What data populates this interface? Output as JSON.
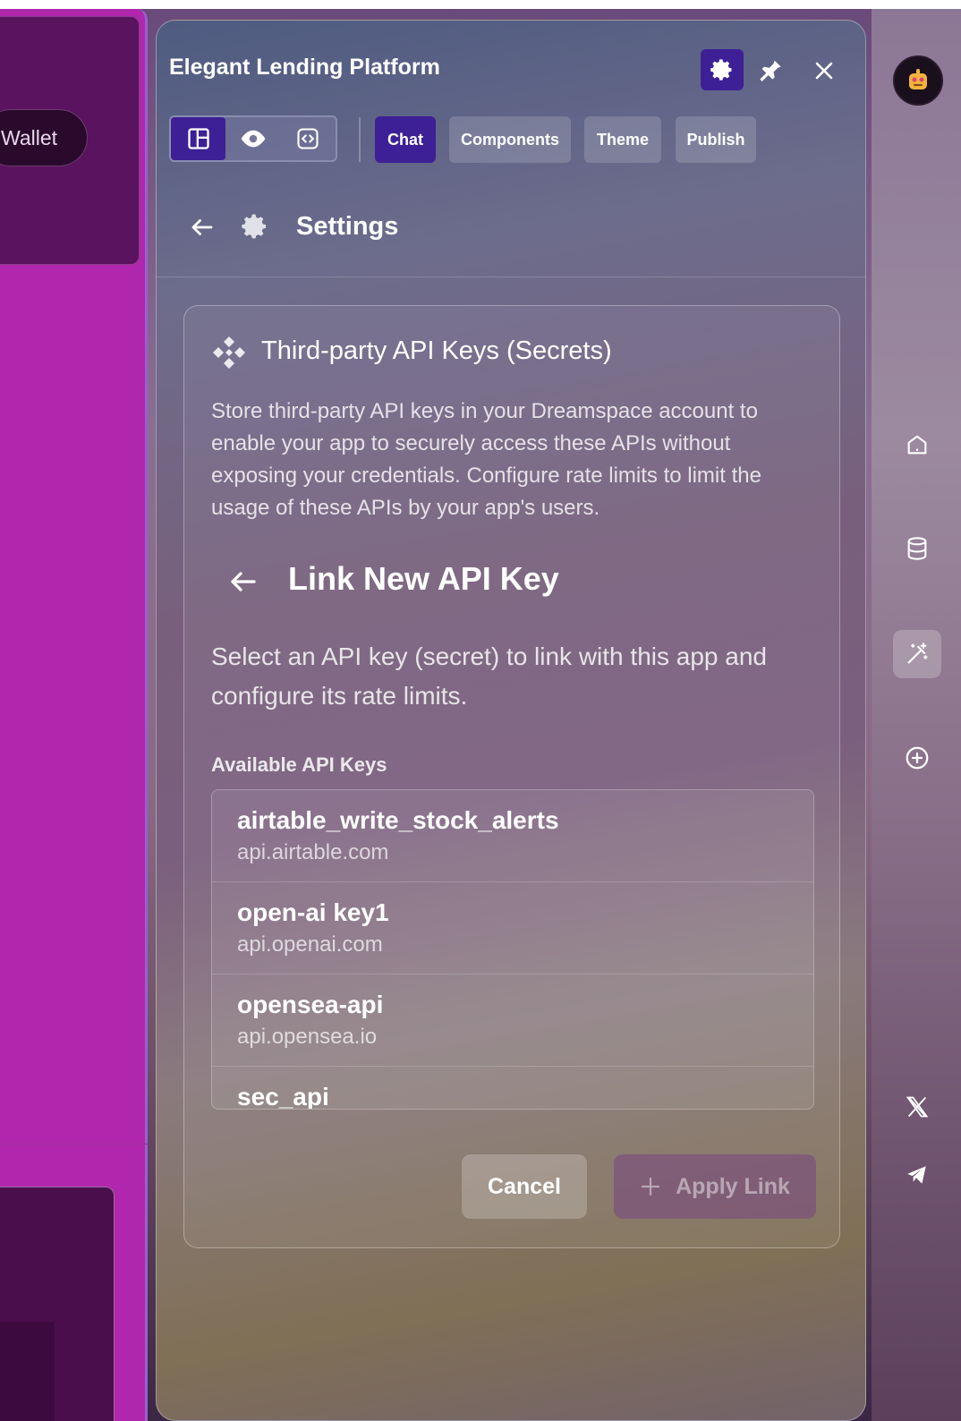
{
  "background_app": {
    "wallet_button_label": "Wallet"
  },
  "header": {
    "title": "Elegant Lending Platform"
  },
  "toolbar": {
    "tabs": [
      {
        "label": "Chat",
        "active": true
      },
      {
        "label": "Components",
        "active": false
      },
      {
        "label": "Theme",
        "active": false
      },
      {
        "label": "Publish",
        "active": false
      }
    ]
  },
  "settings": {
    "title": "Settings"
  },
  "secrets_card": {
    "title": "Third-party API Keys (Secrets)",
    "description": "Store third-party API keys in your Dreamspace account to enable your app to securely access these APIs without exposing your credentials. Configure rate limits to limit the usage of these APIs by your app's users.",
    "link_title": "Link New API Key",
    "link_description": "Select an API key (secret) to link with this app and configure its rate limits.",
    "available_label": "Available API Keys",
    "keys": [
      {
        "name": "airtable_write_stock_alerts",
        "host": "api.airtable.com"
      },
      {
        "name": "open-ai key1",
        "host": "api.openai.com"
      },
      {
        "name": "opensea-api",
        "host": "api.opensea.io"
      },
      {
        "name": "sec_api",
        "host": ""
      }
    ],
    "cancel_label": "Cancel",
    "apply_label": "Apply Link"
  },
  "colors": {
    "accent": "#3d1f96",
    "app_magenta": "#b027ad"
  },
  "icons": {
    "rail": [
      "robot-avatar-icon",
      "home-icon",
      "database-icon",
      "magic-wand-icon",
      "add-circle-icon",
      "x-logo-icon",
      "telegram-icon"
    ]
  }
}
